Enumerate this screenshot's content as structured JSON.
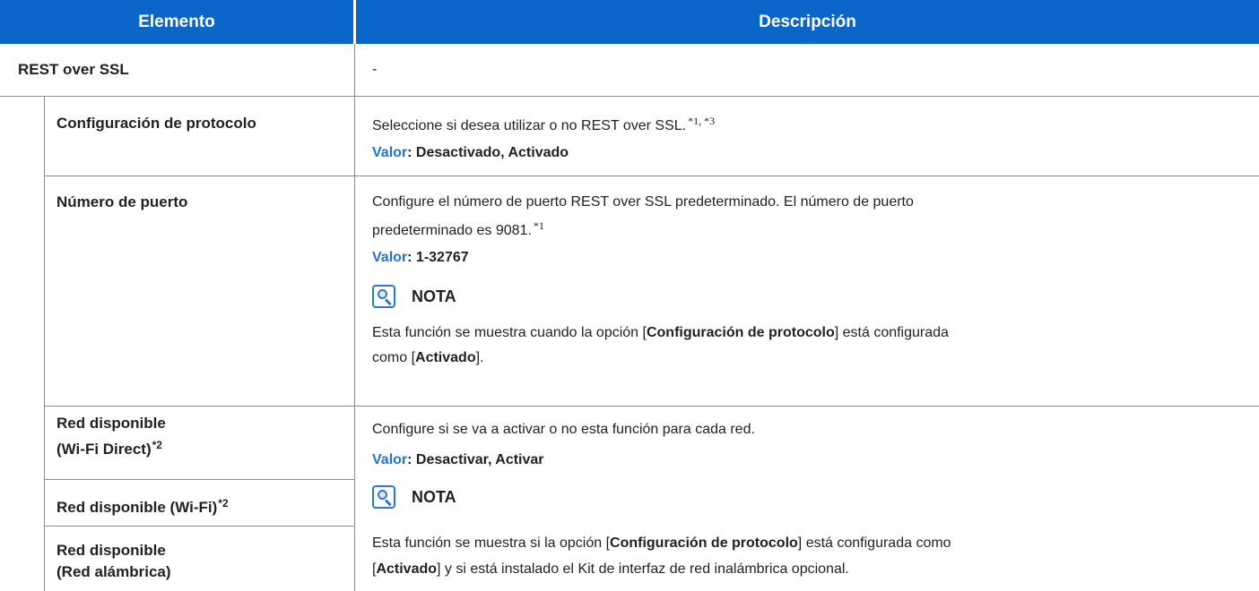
{
  "header": {
    "col1": "Elemento",
    "col2": "Descripción"
  },
  "section": {
    "title": "REST over SSL",
    "desc": "-"
  },
  "rows": {
    "protocol": {
      "label": "Configuración de protocolo",
      "desc": "Seleccione si desea utilizar o no REST over SSL.",
      "notes": "*1,  *3",
      "value_key": "Valor",
      "value": ": Desactivado, Activado"
    },
    "port": {
      "label": "Número de puerto",
      "desc_line1": "Configure el número de puerto REST over SSL predeterminado. El número de puerto",
      "desc_line2": "predeterminado es 9081.",
      "note": "*1",
      "value_key": "Valor",
      "value": ": 1-32767",
      "nota_title": "NOTA",
      "nota_l1_a": "Esta función se muestra cuando la opción [",
      "nota_l1_b": "Configuración de protocolo",
      "nota_l1_c": "] está configurada",
      "nota_l2_a": "como [",
      "nota_l2_b": "Activado",
      "nota_l2_c": "]."
    },
    "network": {
      "label_wfd_1": "Red disponible",
      "label_wfd_2": "(Wi-Fi Direct)",
      "label_wfd_sup": "*2",
      "label_wifi": "Red disponible (Wi-Fi)",
      "label_wifi_sup": "*2",
      "label_wired_1": "Red disponible",
      "label_wired_2": "(Red alámbrica)",
      "desc": "Configure si se va a activar o no esta función para cada red.",
      "value_key": "Valor",
      "value": ": Desactivar, Activar",
      "nota_title": "NOTA",
      "nota_l1_a": "Esta función se muestra si la opción [",
      "nota_l1_b": "Configuración de protocolo",
      "nota_l1_c": "] está configurada como",
      "nota_l2_a": "[",
      "nota_l2_b": "Activado",
      "nota_l2_c": "] y si está instalado el Kit de interfaz de red inalámbrica opcional."
    }
  },
  "colors": {
    "header_bg": "#0a67c9",
    "value_key": "#1f73d6",
    "rule": "#8c8c8c"
  },
  "icons": {
    "nota": "note-magnifier-icon"
  }
}
